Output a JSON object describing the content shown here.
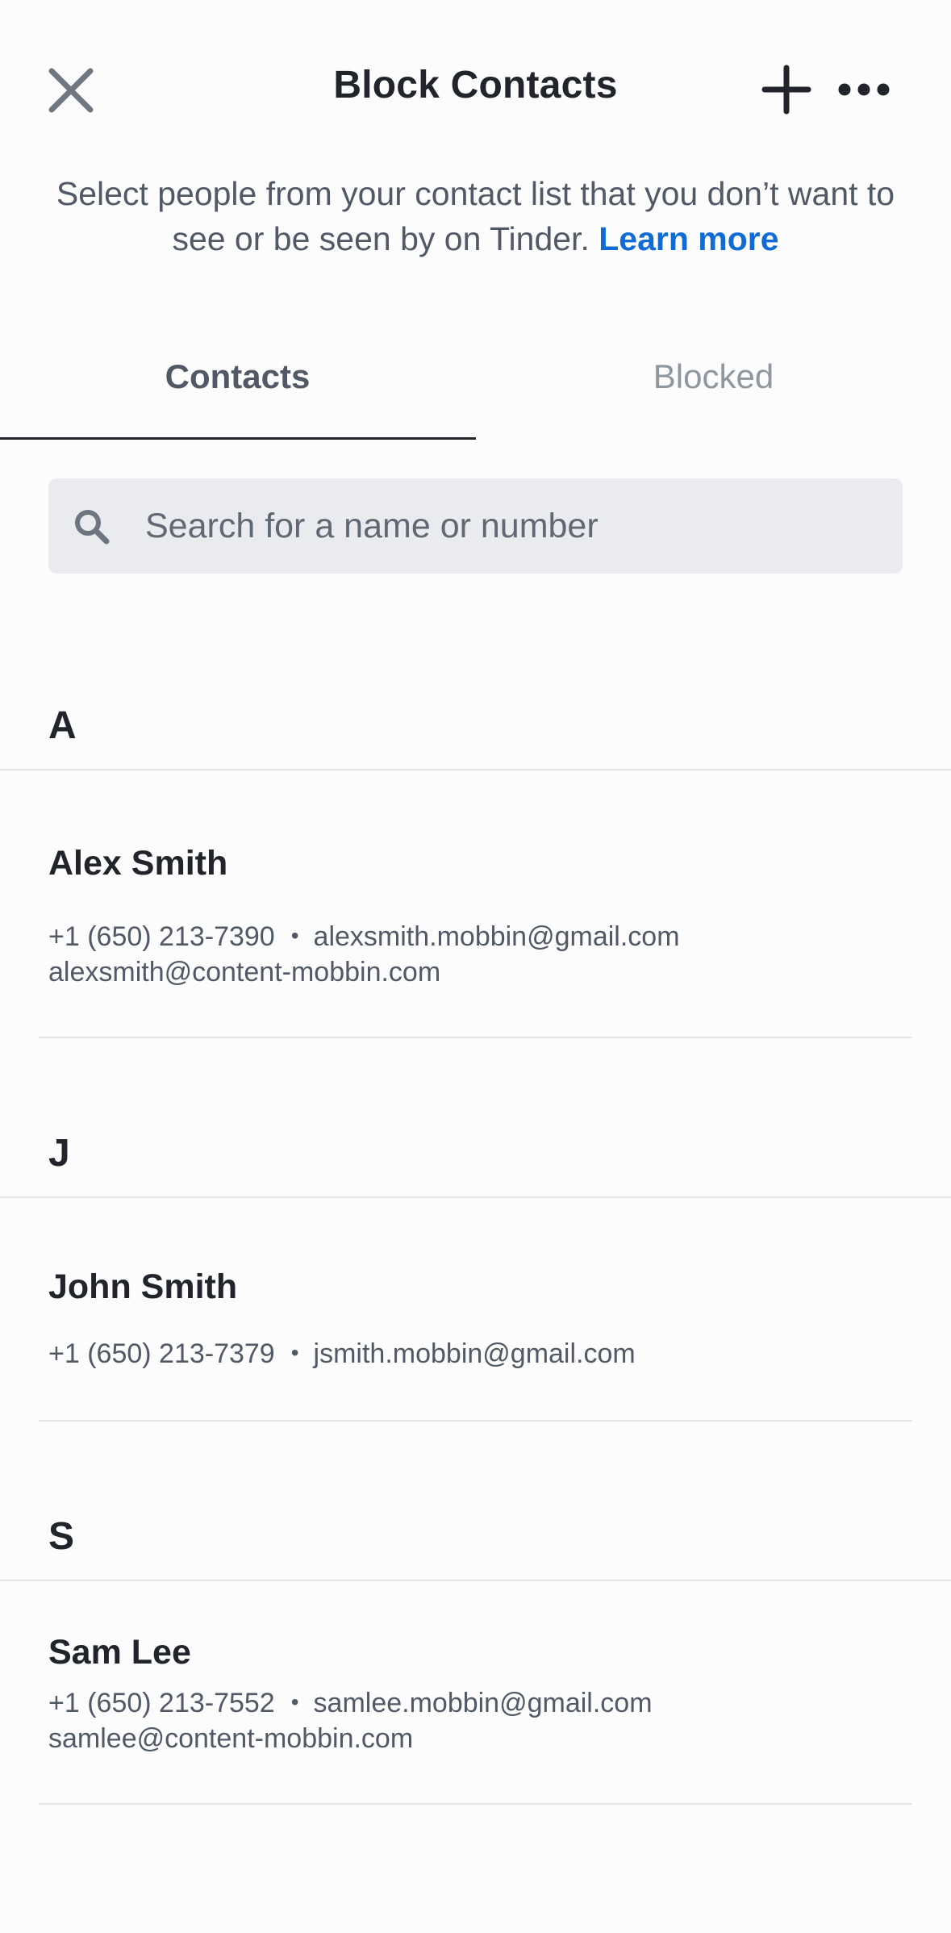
{
  "header": {
    "title": "Block Contacts",
    "close_icon": "close-icon",
    "add_icon": "plus-icon",
    "more_icon": "more-horizontal-icon"
  },
  "description": {
    "text": "Select people from your contact list that you don’t want to see or be seen by on Tinder.",
    "link": "Learn more",
    "link_color": "#106bd5"
  },
  "tabs": [
    {
      "label": "Contacts",
      "active": true
    },
    {
      "label": "Blocked",
      "active": false
    }
  ],
  "search": {
    "placeholder": "Search for a name or number",
    "icon": "search-icon"
  },
  "sections": [
    {
      "letter": "A",
      "contacts": [
        {
          "name": "Alex Smith",
          "phone": "+1 (650) 213-7390",
          "email": "alexsmith.mobbin@gmail.com",
          "email2": "alexsmith@content-mobbin.com"
        }
      ]
    },
    {
      "letter": "J",
      "contacts": [
        {
          "name": "John Smith",
          "phone": "+1 (650) 213-7379",
          "email": "jsmith.mobbin@gmail.com"
        }
      ]
    },
    {
      "letter": "S",
      "contacts": [
        {
          "name": "Sam Lee",
          "phone": "+1 (650) 213-7552",
          "email": "samlee.mobbin@gmail.com",
          "email2": "samlee@content-mobbin.com"
        }
      ]
    }
  ],
  "separator": "•"
}
